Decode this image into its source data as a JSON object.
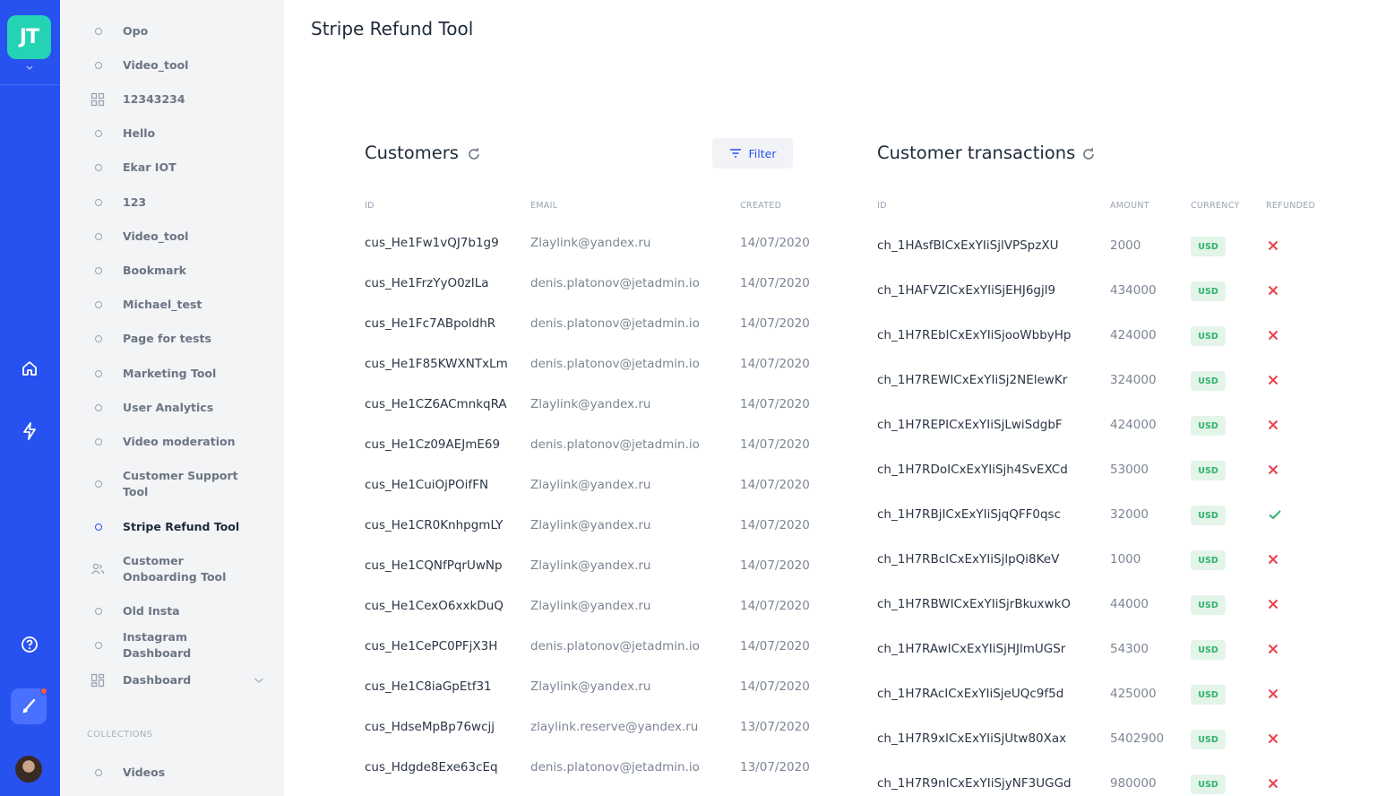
{
  "app": {
    "logo_text": "JT",
    "accent": "#2752f0",
    "logo_color": "#24d3b4"
  },
  "rail": {
    "icons": [
      "home-icon",
      "lightning-icon",
      "help-icon",
      "brush-icon"
    ]
  },
  "sidebar": {
    "items": [
      {
        "label": "Opo",
        "icon": "circle"
      },
      {
        "label": "Video_tool",
        "icon": "circle"
      },
      {
        "label": "12343234",
        "icon": "grid"
      },
      {
        "label": "Hello",
        "icon": "circle"
      },
      {
        "label": "Ekar IOT",
        "icon": "circle"
      },
      {
        "label": "123",
        "icon": "circle"
      },
      {
        "label": "Video_tool",
        "icon": "circle"
      },
      {
        "label": "Bookmark",
        "icon": "circle"
      },
      {
        "label": "Michael_test",
        "icon": "circle"
      },
      {
        "label": "Page for tests",
        "icon": "circle"
      },
      {
        "label": "Marketing Tool",
        "icon": "circle"
      },
      {
        "label": "User Analytics",
        "icon": "circle"
      },
      {
        "label": "Video moderation",
        "icon": "circle"
      },
      {
        "label": "Customer Support Tool",
        "icon": "circle"
      },
      {
        "label": "Stripe Refund Tool",
        "icon": "circle",
        "active": true
      },
      {
        "label": "Customer Onboarding Tool",
        "icon": "users"
      },
      {
        "label": "Old Insta",
        "icon": "circle"
      },
      {
        "label": "Instagram Dashboard",
        "icon": "circle"
      },
      {
        "label": "Dashboard",
        "icon": "dashboard"
      }
    ],
    "collections_label": "COLLECTIONS",
    "collections": [
      {
        "label": "Videos"
      }
    ]
  },
  "page": {
    "title": "Stripe Refund Tool"
  },
  "customers": {
    "title": "Customers",
    "filter_label": "Filter",
    "columns": [
      "ID",
      "EMAIL",
      "CREATED"
    ],
    "rows": [
      [
        "cus_He1Fw1vQJ7b1g9",
        "Zlaylink@yandex.ru",
        "14/07/2020"
      ],
      [
        "cus_He1FrzYyO0zILa",
        "denis.platonov@jetadmin.io",
        "14/07/2020"
      ],
      [
        "cus_He1Fc7ABpoldhR",
        "denis.platonov@jetadmin.io",
        "14/07/2020"
      ],
      [
        "cus_He1F85KWXNTxLm",
        "denis.platonov@jetadmin.io",
        "14/07/2020"
      ],
      [
        "cus_He1CZ6ACmnkqRA",
        "Zlaylink@yandex.ru",
        "14/07/2020"
      ],
      [
        "cus_He1Cz09AEJmE69",
        "denis.platonov@jetadmin.io",
        "14/07/2020"
      ],
      [
        "cus_He1CuiOjPOifFN",
        "Zlaylink@yandex.ru",
        "14/07/2020"
      ],
      [
        "cus_He1CR0KnhpgmLY",
        "Zlaylink@yandex.ru",
        "14/07/2020"
      ],
      [
        "cus_He1CQNfPqrUwNp",
        "Zlaylink@yandex.ru",
        "14/07/2020"
      ],
      [
        "cus_He1CexO6xxkDuQ",
        "Zlaylink@yandex.ru",
        "14/07/2020"
      ],
      [
        "cus_He1CePC0PFjX3H",
        "denis.platonov@jetadmin.io",
        "14/07/2020"
      ],
      [
        "cus_He1C8iaGpEtf31",
        "Zlaylink@yandex.ru",
        "14/07/2020"
      ],
      [
        "cus_HdseMpBp76wcjj",
        "zlaylink.reserve@yandex.ru",
        "13/07/2020"
      ],
      [
        "cus_Hdgde8Exe63cEq",
        "denis.platonov@jetadmin.io",
        "13/07/2020"
      ]
    ]
  },
  "transactions": {
    "title": "Customer transactions",
    "columns": [
      "ID",
      "AMOUNT",
      "CURRENCY",
      "REFUNDED"
    ],
    "rows": [
      [
        "ch_1HAsfBICxExYIiSjlVPSpzXU",
        "2000",
        "USD",
        false
      ],
      [
        "ch_1HAFVZICxExYIiSjEHJ6gjl9",
        "434000",
        "USD",
        false
      ],
      [
        "ch_1H7REbICxExYIiSjooWbbyHp",
        "424000",
        "USD",
        false
      ],
      [
        "ch_1H7REWICxExYIiSj2NElewKr",
        "324000",
        "USD",
        false
      ],
      [
        "ch_1H7REPICxExYIiSjLwiSdgbF",
        "424000",
        "USD",
        false
      ],
      [
        "ch_1H7RDoICxExYIiSjh4SvEXCd",
        "53000",
        "USD",
        false
      ],
      [
        "ch_1H7RBjICxExYIiSjqQFF0qsc",
        "32000",
        "USD",
        true
      ],
      [
        "ch_1H7RBcICxExYIiSjlpQi8KeV",
        "1000",
        "USD",
        false
      ],
      [
        "ch_1H7RBWICxExYIiSjrBkuxwkO",
        "44000",
        "USD",
        false
      ],
      [
        "ch_1H7RAwICxExYIiSjHJlmUGSr",
        "54300",
        "USD",
        false
      ],
      [
        "ch_1H7RAcICxExYIiSjeUQc9f5d",
        "425000",
        "USD",
        false
      ],
      [
        "ch_1H7R9xICxExYIiSjUtw80Xax",
        "5402900",
        "USD",
        false
      ],
      [
        "ch_1H7R9nICxExYIiSjyNF3UGGd",
        "980000",
        "USD",
        false
      ]
    ]
  }
}
